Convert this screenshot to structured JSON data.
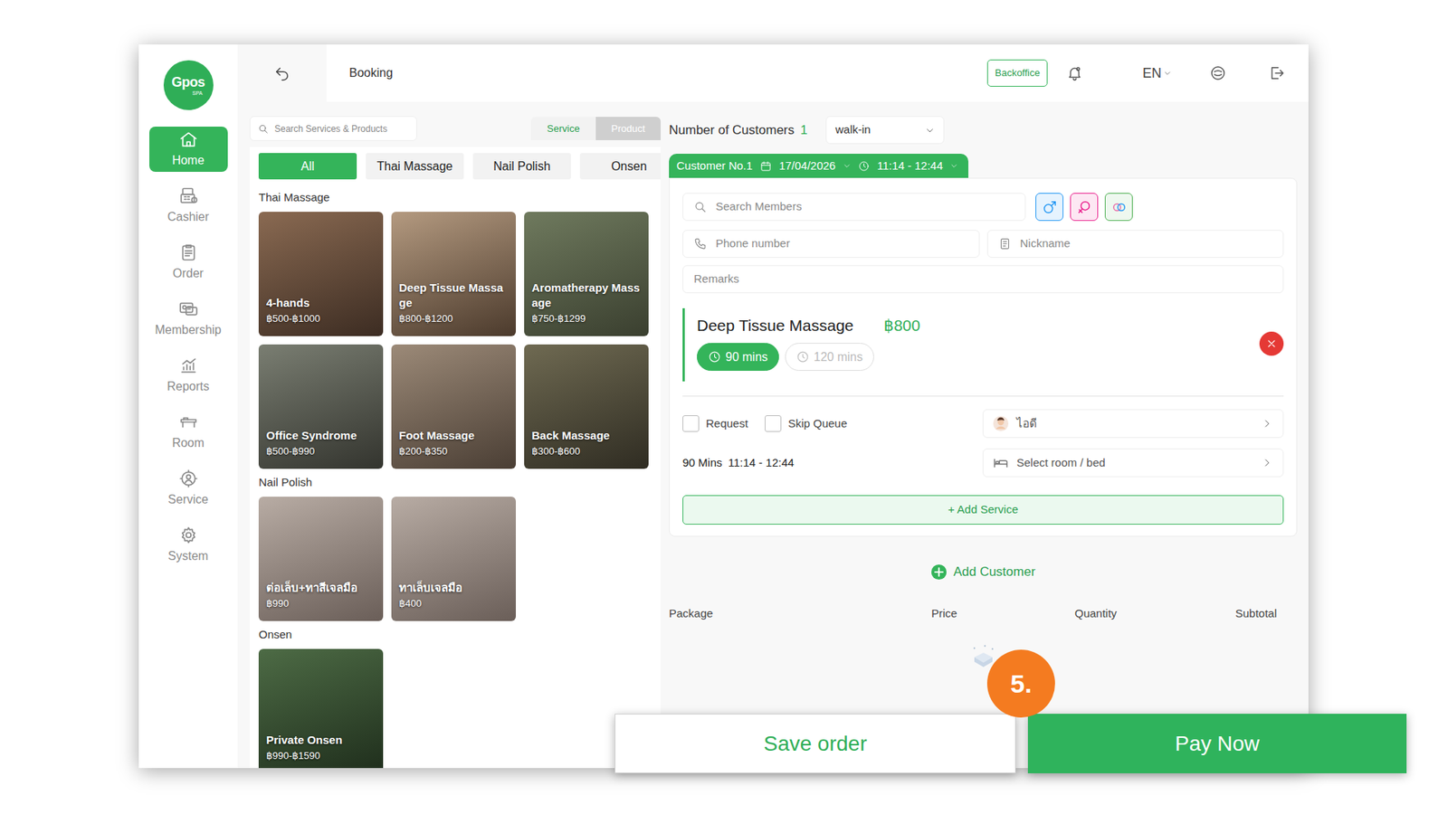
{
  "logo": {
    "text": "Gpos",
    "sub": "SPA"
  },
  "sidebar": {
    "items": [
      {
        "label": "Home",
        "selected": true
      },
      {
        "label": "Cashier",
        "selected": false
      },
      {
        "label": "Order",
        "selected": false
      },
      {
        "label": "Membership",
        "selected": false
      },
      {
        "label": "Reports",
        "selected": false
      },
      {
        "label": "Room",
        "selected": false
      },
      {
        "label": "Service",
        "selected": false
      },
      {
        "label": "System",
        "selected": false
      }
    ]
  },
  "topbar": {
    "title": "Booking",
    "backoffice": "Backoffice",
    "language": "EN"
  },
  "catalog": {
    "search": {
      "placeholder": "Search Services & Products"
    },
    "modes": [
      {
        "label": "Service",
        "selected": true
      },
      {
        "label": "Product",
        "selected": false
      }
    ],
    "categories": [
      {
        "label": "All",
        "selected": true
      },
      {
        "label": "Thai Massage",
        "selected": false
      },
      {
        "label": "Nail Polish",
        "selected": false
      },
      {
        "label": "Onsen",
        "selected": false
      }
    ],
    "sections": [
      {
        "title": "Thai Massage",
        "items": [
          {
            "name": "4-hands",
            "price": "฿500-฿1000"
          },
          {
            "name": "Deep Tissue Massage",
            "price": "฿800-฿1200"
          },
          {
            "name": "Aromatherapy Massage",
            "price": "฿750-฿1299"
          },
          {
            "name": "Office Syndrome",
            "price": "฿500-฿990"
          },
          {
            "name": "Foot Massage",
            "price": "฿200-฿350"
          },
          {
            "name": "Back Massage",
            "price": "฿300-฿600"
          }
        ]
      },
      {
        "title": "Nail Polish",
        "items": [
          {
            "name": "ต่อเล็บ+ทาสีเจลมือ",
            "price": "฿990"
          },
          {
            "name": "ทาเล็บเจลมือ",
            "price": "฿400"
          }
        ]
      },
      {
        "title": "Onsen",
        "items": [
          {
            "name": "Private Onsen",
            "price": "฿990-฿1590"
          }
        ]
      }
    ]
  },
  "booking": {
    "customers_label": "Number of Customers",
    "customers_count": "1",
    "customer_type": "walk-in",
    "customer_tab": {
      "label": "Customer No.1",
      "date": "17/04/2026",
      "time": "11:14 - 12:44"
    },
    "member_search": {
      "placeholder": "Search Members"
    },
    "phone": {
      "placeholder": "Phone number"
    },
    "nickname": {
      "placeholder": "Nickname"
    },
    "remarks": {
      "placeholder": "Remarks"
    },
    "service": {
      "name": "Deep Tissue Massage",
      "price": "฿800",
      "durations": [
        {
          "label": "90 mins",
          "selected": true
        },
        {
          "label": "120 mins",
          "selected": false
        }
      ],
      "request": {
        "label": "Request",
        "checked": false
      },
      "skip_queue": {
        "label": "Skip Queue",
        "checked": false
      },
      "therapist": "ไอดี",
      "schedule_duration": "90 Mins",
      "schedule_time": "11:14 - 12:44",
      "room": "Select room / bed"
    },
    "add_service": "+ Add Service",
    "add_customer": "Add Customer",
    "table": {
      "columns": [
        "Package",
        "Price",
        "Quantity",
        "Subtotal"
      ]
    }
  },
  "annotation": {
    "step": "5."
  },
  "actions": [
    {
      "label": "Save order",
      "kind": "secondary"
    },
    {
      "label": "Pay Now",
      "kind": "primary"
    }
  ]
}
